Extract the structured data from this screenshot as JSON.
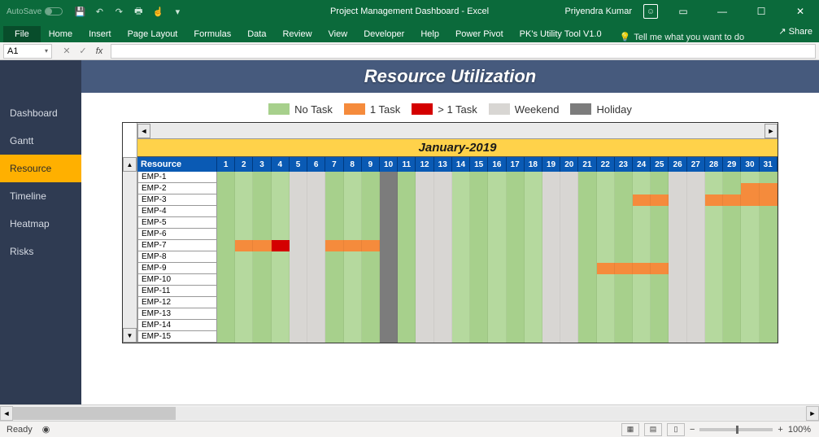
{
  "titlebar": {
    "autosave_label": "AutoSave",
    "title": "Project Management Dashboard  -  Excel",
    "username": "Priyendra Kumar"
  },
  "ribbon": {
    "tabs": [
      "File",
      "Home",
      "Insert",
      "Page Layout",
      "Formulas",
      "Data",
      "Review",
      "View",
      "Developer",
      "Help",
      "Power Pivot",
      "PK's Utility Tool V1.0"
    ],
    "tellme": "Tell me what you want to do",
    "share": "Share"
  },
  "formulabar": {
    "namebox": "A1"
  },
  "sidenav": {
    "items": [
      "Dashboard",
      "Gantt",
      "Resource",
      "Timeline",
      "Heatmap",
      "Risks"
    ],
    "active": "Resource"
  },
  "header": {
    "title": "Resource Utilization"
  },
  "legend": {
    "items": [
      {
        "color": "#a7d08c",
        "label": "No Task"
      },
      {
        "color": "#f58b3c",
        "label": "1 Task"
      },
      {
        "color": "#d40000",
        "label": "> 1 Task"
      },
      {
        "color": "#d8d6d3",
        "label": "Weekend"
      },
      {
        "color": "#7c7c7c",
        "label": "Holiday"
      }
    ]
  },
  "month": "January-2019",
  "resourceHeader": "Resource",
  "days": 31,
  "weekends": [
    5,
    6,
    12,
    13,
    19,
    20,
    26,
    27
  ],
  "holidays": [
    10
  ],
  "resources": [
    "EMP-1",
    "EMP-2",
    "EMP-3",
    "EMP-4",
    "EMP-5",
    "EMP-6",
    "EMP-7",
    "EMP-8",
    "EMP-9",
    "EMP-10",
    "EMP-11",
    "EMP-12",
    "EMP-13",
    "EMP-14",
    "EMP-15"
  ],
  "tasks": {
    "EMP-2": {
      "30": 1,
      "31": 1
    },
    "EMP-3": {
      "24": 1,
      "25": 1,
      "28": 1,
      "29": 1,
      "30": 1,
      "31": 1
    },
    "EMP-7": {
      "2": 1,
      "3": 1,
      "4": 2,
      "7": 1,
      "8": 1,
      "9": 1
    },
    "EMP-9": {
      "22": 1,
      "23": 1,
      "24": 1,
      "25": 1
    }
  },
  "status": {
    "ready": "Ready",
    "zoom": "100%"
  },
  "colors": {
    "notask": "#a7d08c",
    "notaskAlt": "#b5d99e",
    "task1": "#f58b3c",
    "taskN": "#d40000",
    "weekend": "#d8d6d3",
    "holiday": "#7c7c7c"
  }
}
